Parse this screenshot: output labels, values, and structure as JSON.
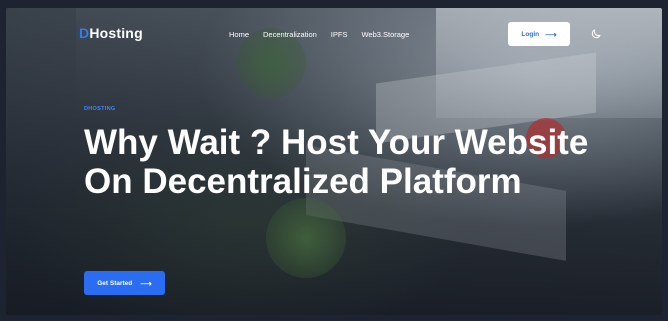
{
  "brand": {
    "prefix": "D",
    "name": "Hosting"
  },
  "nav": {
    "items": [
      "Home",
      "Decentralization",
      "IPFS",
      "Web3.Storage"
    ],
    "login_label": "Login",
    "login_icon": "arrow-right-icon",
    "theme_icon": "moon-icon"
  },
  "hero": {
    "eyebrow": "DHOSTING",
    "title": "Why Wait ? Host Your Website On Decentralized Platform",
    "cta_label": "Get Started",
    "cta_icon": "arrow-right-icon"
  },
  "colors": {
    "accent": "#2a6df2",
    "brand_d": "#2f7cf6"
  }
}
